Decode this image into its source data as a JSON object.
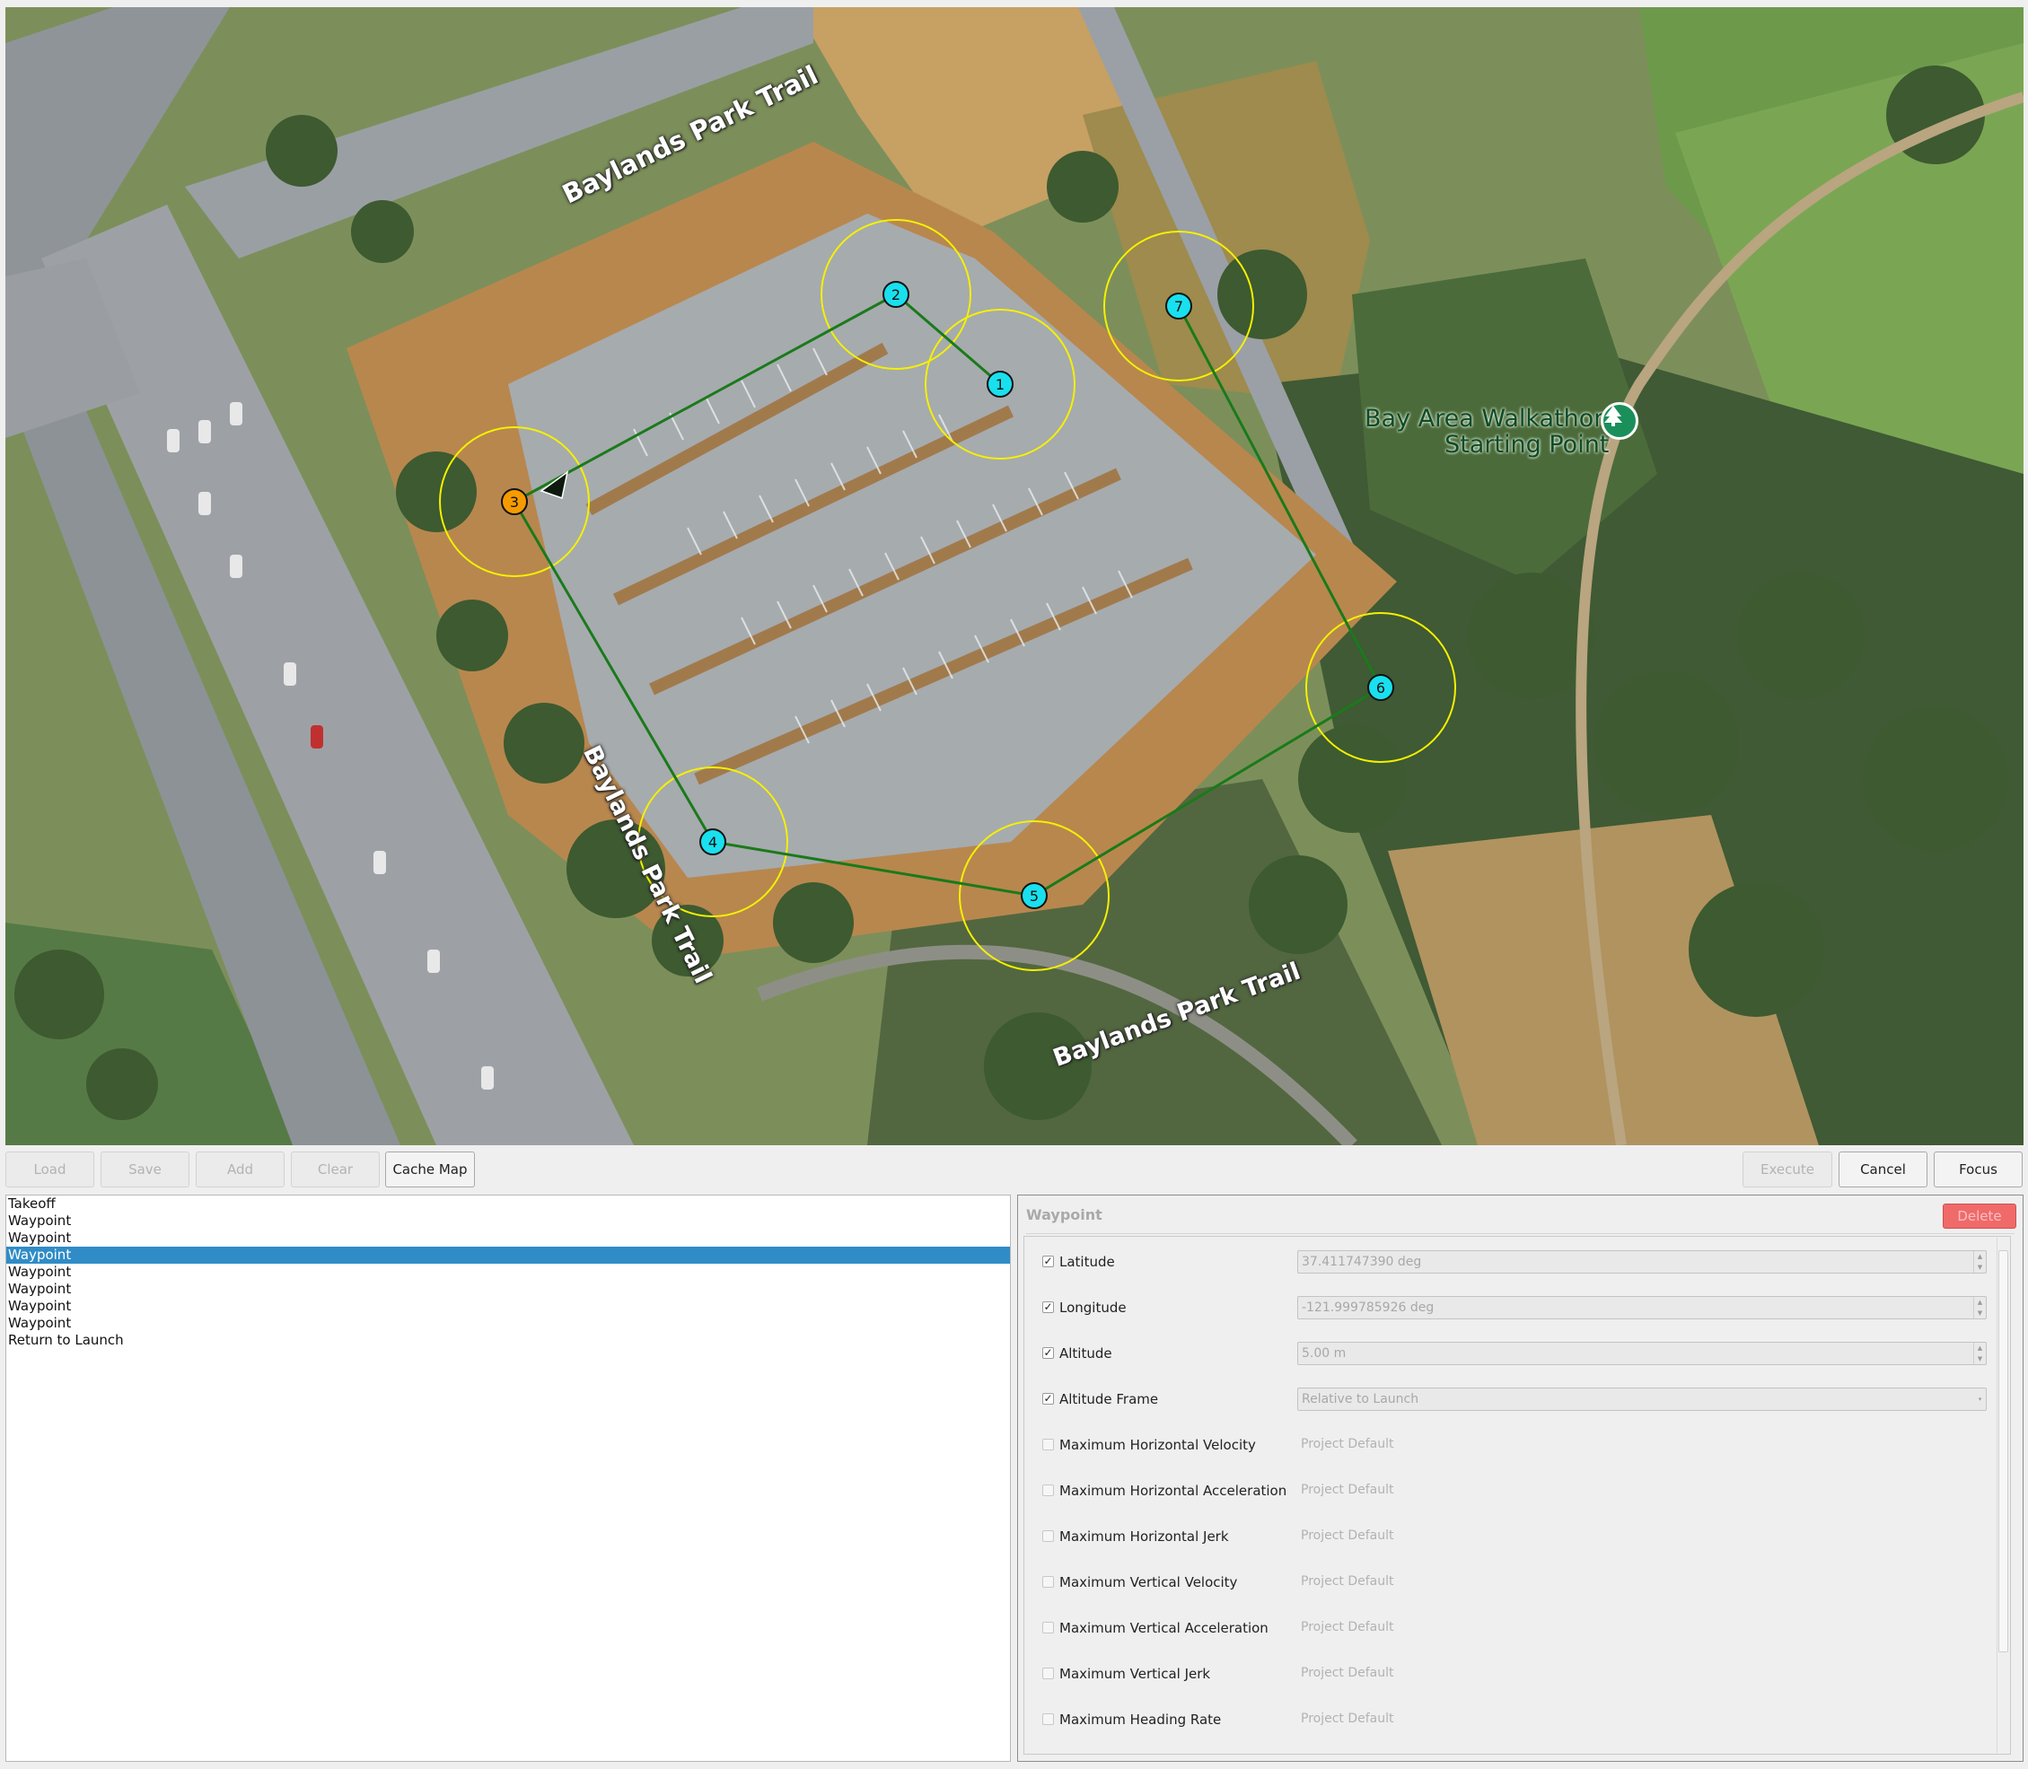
{
  "map": {
    "road_labels": [
      {
        "text": "Baylands Park Trail"
      },
      {
        "text": "Baylands Park Trail"
      },
      {
        "text": "Baylands Park Trail"
      }
    ],
    "poi": {
      "name_line1": "Bay Area Walkathon",
      "name_line2": "Starting Point",
      "icon": "tree-icon"
    },
    "waypoints": [
      {
        "label": "1",
        "active": false
      },
      {
        "label": "2",
        "active": false
      },
      {
        "label": "3",
        "active": true
      },
      {
        "label": "4",
        "active": false
      },
      {
        "label": "5",
        "active": false
      },
      {
        "label": "6",
        "active": false
      },
      {
        "label": "7",
        "active": false
      }
    ],
    "colors": {
      "path": "#1a7a1a",
      "acceptance_circle": "#f5f000",
      "waypoint": "#19e0ee",
      "active_waypoint": "#f59b00"
    }
  },
  "toolbar": {
    "load": "Load",
    "save": "Save",
    "add": "Add",
    "clear": "Clear",
    "cache_map": "Cache Map",
    "execute": "Execute",
    "cancel": "Cancel",
    "focus": "Focus"
  },
  "mission_items": [
    {
      "label": "Takeoff",
      "selected": false
    },
    {
      "label": "Waypoint",
      "selected": false
    },
    {
      "label": "Waypoint",
      "selected": false
    },
    {
      "label": "Waypoint",
      "selected": true
    },
    {
      "label": "Waypoint",
      "selected": false
    },
    {
      "label": "Waypoint",
      "selected": false
    },
    {
      "label": "Waypoint",
      "selected": false
    },
    {
      "label": "Waypoint",
      "selected": false
    },
    {
      "label": "Return to Launch",
      "selected": false
    }
  ],
  "waypoint_panel": {
    "title": "Waypoint",
    "delete_label": "Delete",
    "params": [
      {
        "label": "Latitude",
        "checked": true,
        "value": "37.411747390 deg",
        "kind": "spin"
      },
      {
        "label": "Longitude",
        "checked": true,
        "value": "-121.999785926 deg",
        "kind": "spin"
      },
      {
        "label": "Altitude",
        "checked": true,
        "value": "5.00 m",
        "kind": "spin"
      },
      {
        "label": "Altitude Frame",
        "checked": true,
        "value": "Relative to Launch",
        "kind": "combo"
      },
      {
        "label": "Maximum Horizontal Velocity",
        "checked": false,
        "value": "Project Default",
        "kind": "default"
      },
      {
        "label": "Maximum Horizontal Acceleration",
        "checked": false,
        "value": "Project Default",
        "kind": "default"
      },
      {
        "label": "Maximum Horizontal Jerk",
        "checked": false,
        "value": "Project Default",
        "kind": "default"
      },
      {
        "label": "Maximum Vertical Velocity",
        "checked": false,
        "value": "Project Default",
        "kind": "default"
      },
      {
        "label": "Maximum Vertical Acceleration",
        "checked": false,
        "value": "Project Default",
        "kind": "default"
      },
      {
        "label": "Maximum Vertical Jerk",
        "checked": false,
        "value": "Project Default",
        "kind": "default"
      },
      {
        "label": "Maximum Heading Rate",
        "checked": false,
        "value": "Project Default",
        "kind": "default"
      }
    ]
  }
}
